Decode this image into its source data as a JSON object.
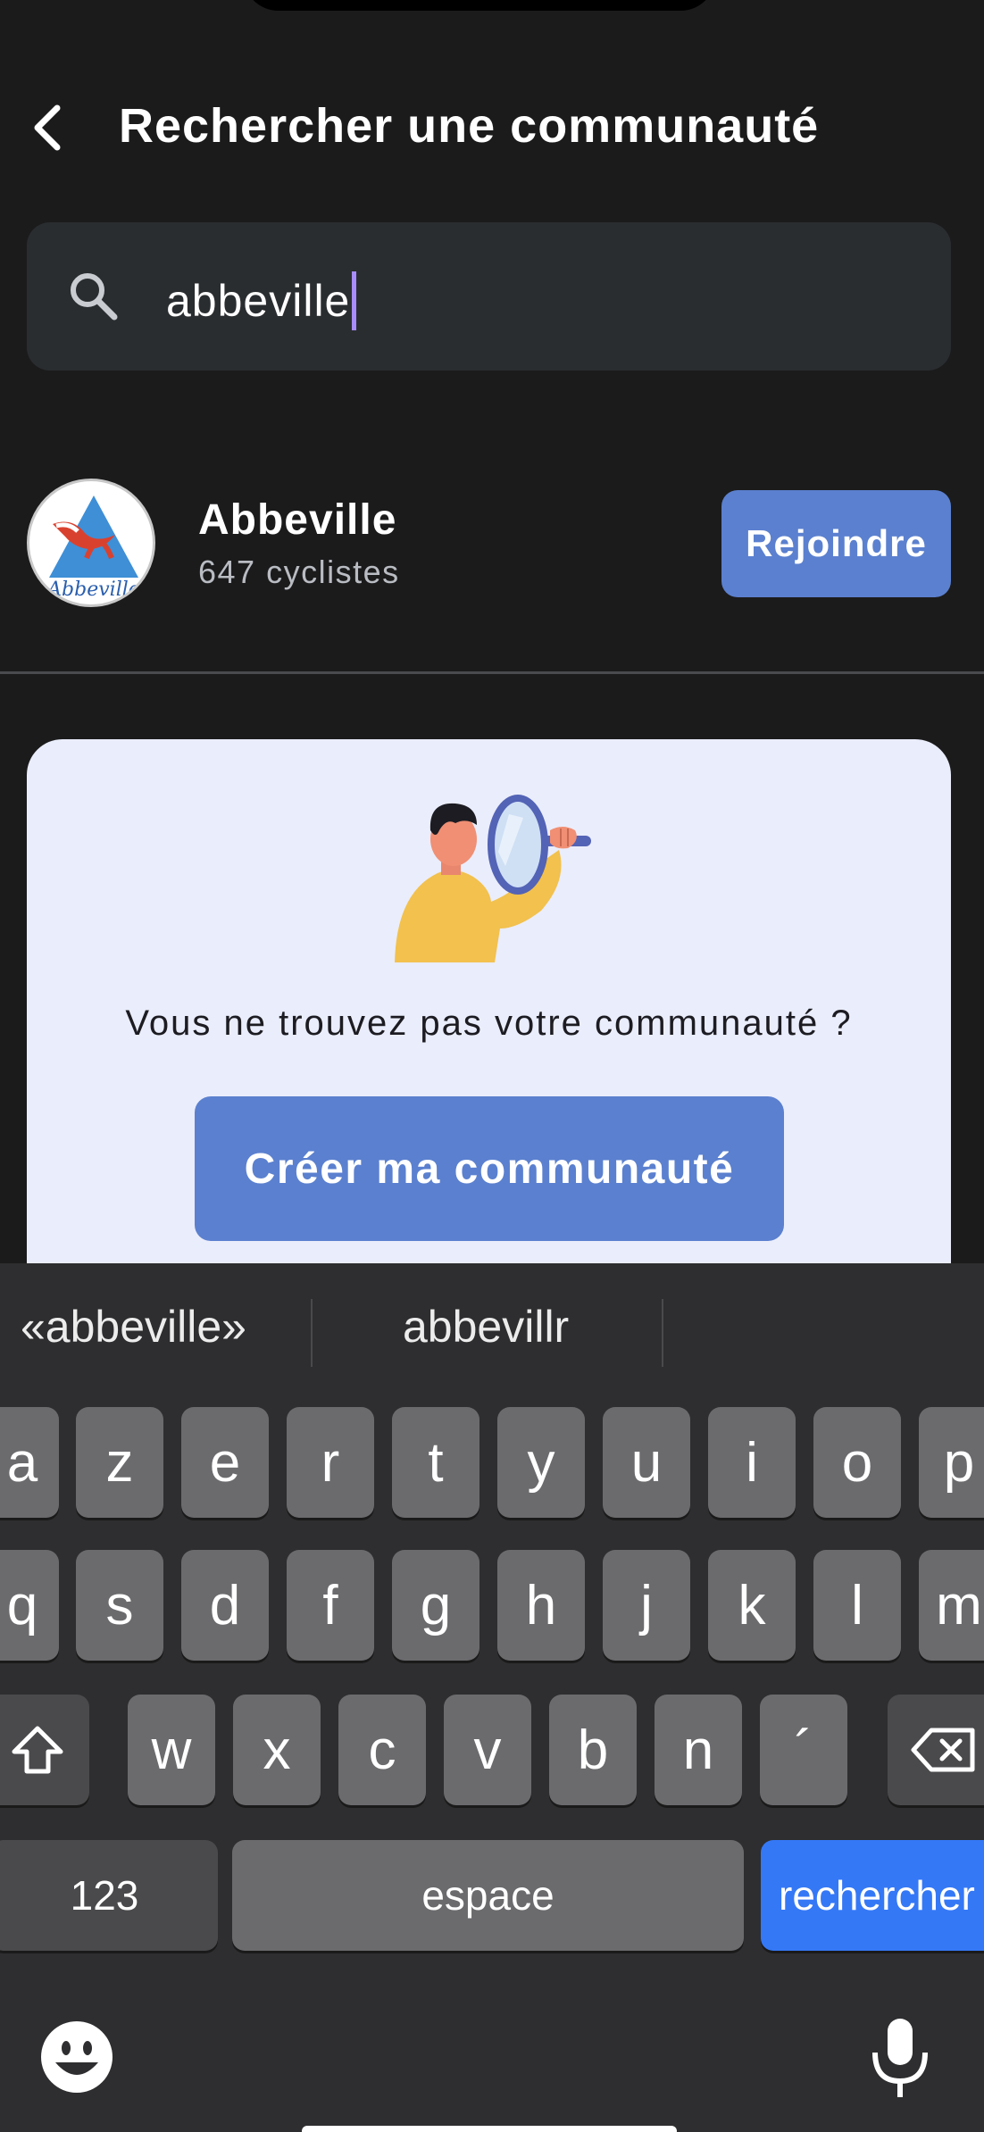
{
  "header": {
    "title": "Rechercher une communauté",
    "back_icon": "chevron-left-icon"
  },
  "search": {
    "icon": "search-icon",
    "value": "abbeville",
    "placeholder": ""
  },
  "result": {
    "name": "Abbeville",
    "subtitle": "647 cyclistes",
    "logo_text": "Abbeville",
    "join_label": "Rejoindre"
  },
  "card": {
    "text": "Vous ne trouvez pas votre communauté ?",
    "button_label": "Créer ma communauté"
  },
  "keyboard": {
    "suggestions": [
      "«abbeville»",
      "abbevillr"
    ],
    "row1": [
      "a",
      "z",
      "e",
      "r",
      "t",
      "y",
      "u",
      "i",
      "o",
      "p"
    ],
    "row2": [
      "q",
      "s",
      "d",
      "f",
      "g",
      "h",
      "j",
      "k",
      "l",
      "m"
    ],
    "row3": [
      "w",
      "x",
      "c",
      "v",
      "b",
      "n",
      "´"
    ],
    "numbers_label": "123",
    "space_label": "espace",
    "return_label": "rechercher"
  },
  "colors": {
    "background": "#1b1b1c",
    "accent": "#5b80cf",
    "card": "#eaedfb",
    "keyboard_return": "#3478f6"
  }
}
